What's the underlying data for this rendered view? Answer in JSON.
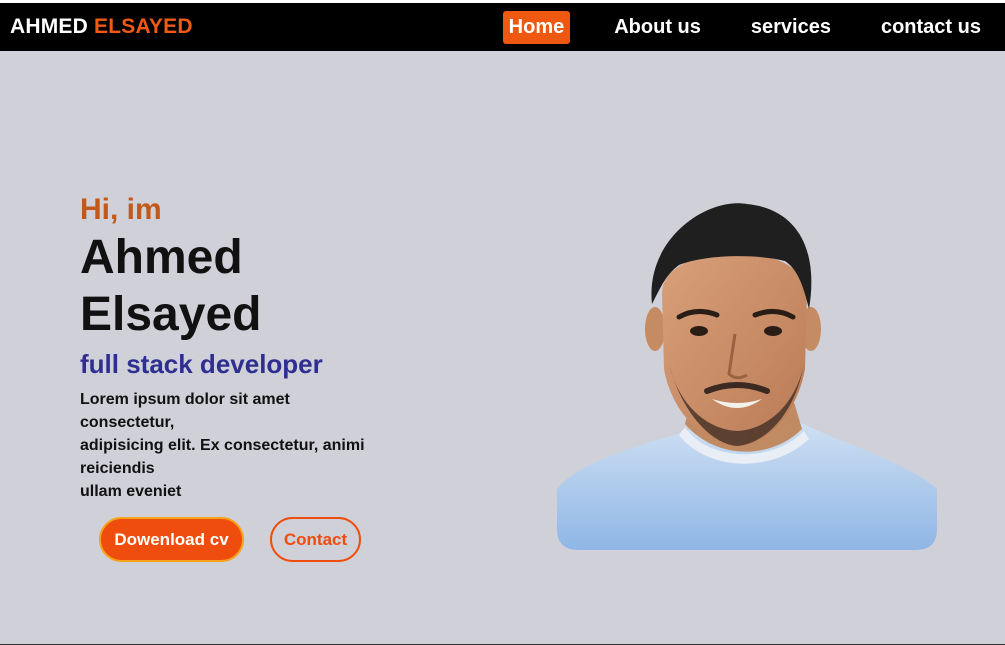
{
  "navbar": {
    "brand_first": "AHMED",
    "brand_last": "ELSAYED",
    "links": [
      {
        "label": "Home",
        "active": true
      },
      {
        "label": "About us",
        "active": false
      },
      {
        "label": "services",
        "active": false
      },
      {
        "label": "contact us",
        "active": false
      }
    ]
  },
  "hero": {
    "greeting": "Hi, im",
    "name": "Ahmed Elsayed",
    "role": "full stack developer",
    "bio_lines": [
      "Lorem ipsum dolor sit amet consectetur,",
      "adipisicing elit. Ex consectetur, animi reiciendis",
      "ullam eveniet"
    ],
    "buttons": {
      "download_cv": "Dowenload cv",
      "contact": "Contact"
    },
    "photo_icon": "profile-photo"
  },
  "colors": {
    "navbar_bg": "#000000",
    "accent": "#ef5811",
    "hero_bg": "#cfd0d8",
    "greeting": "#c45818",
    "role": "#2e2f91"
  }
}
